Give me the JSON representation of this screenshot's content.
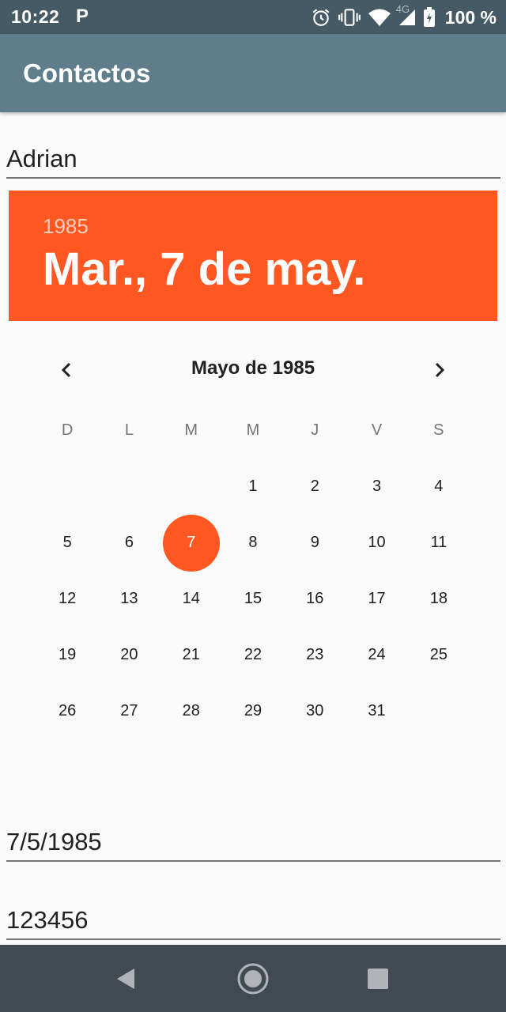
{
  "status_bar": {
    "time": "10:22",
    "notification": "P",
    "battery": "100 %",
    "network": "4G",
    "icons": [
      "alarm-icon",
      "vibrate-icon",
      "wifi-icon",
      "signal-icon",
      "battery-icon"
    ]
  },
  "app_bar": {
    "title": "Contactos",
    "background": "#607d8b"
  },
  "form": {
    "name_value": "Adrian",
    "date_value": "7/5/1985",
    "phone_value": "123456"
  },
  "date_picker": {
    "accent": "#ff5722",
    "year": "1985",
    "selected_date": "Mar., 7 de may.",
    "month_title": "Mayo de 1985",
    "weekdays": [
      "D",
      "L",
      "M",
      "M",
      "J",
      "V",
      "S"
    ],
    "weeks": [
      [
        "",
        "",
        "",
        "1",
        "2",
        "3",
        "4"
      ],
      [
        "5",
        "6",
        "7",
        "8",
        "9",
        "10",
        "11"
      ],
      [
        "12",
        "13",
        "14",
        "15",
        "16",
        "17",
        "18"
      ],
      [
        "19",
        "20",
        "21",
        "22",
        "23",
        "24",
        "25"
      ],
      [
        "26",
        "27",
        "28",
        "29",
        "30",
        "31",
        ""
      ]
    ],
    "selected_day": "7"
  },
  "nav_bar": {
    "icons": [
      "back-icon",
      "home-icon",
      "recents-icon"
    ]
  }
}
